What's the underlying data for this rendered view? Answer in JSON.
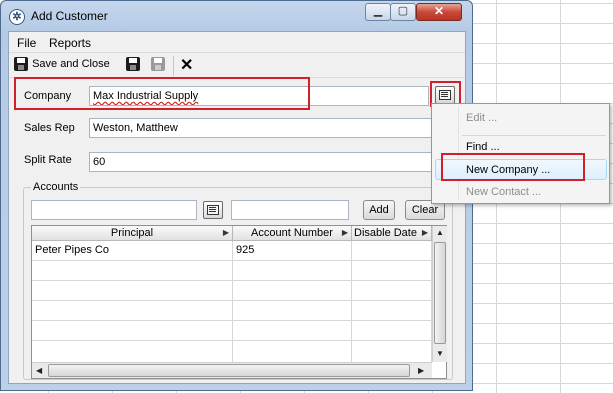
{
  "window": {
    "title": "Add Customer"
  },
  "menubar": {
    "items": [
      "File",
      "Reports"
    ]
  },
  "toolbar": {
    "save_close_label": "Save and Close"
  },
  "form": {
    "company_label": "Company",
    "company_value": "Max Industrial Supply",
    "sales_rep_label": "Sales Rep",
    "sales_rep_value": "Weston, Matthew",
    "split_rate_label": "Split Rate",
    "split_rate_value": "60"
  },
  "accounts": {
    "title": "Accounts",
    "add_label": "Add",
    "clear_label": "Clear",
    "columns": [
      "Principal",
      "Account Number",
      "Disable Date"
    ],
    "rows": [
      [
        "Peter Pipes Co",
        "925",
        ""
      ]
    ]
  },
  "context_menu": {
    "items": [
      "Edit ...",
      "Find ...",
      "New Company ...",
      "New Contact ..."
    ]
  },
  "colors": {
    "highlight": "#d2202a",
    "titlebar": "#b5cbe5"
  }
}
